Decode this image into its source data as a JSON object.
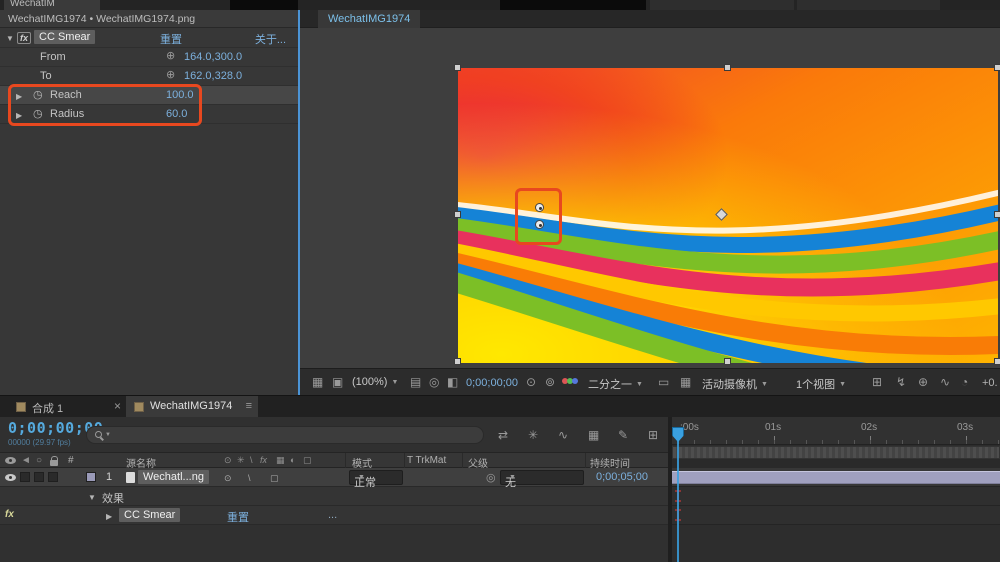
{
  "window": {
    "top_left_tab": "WechatIM"
  },
  "effect_controls": {
    "breadcrumb": "WechatIMG1974 • WechatIMG1974.png",
    "effect_name": "CC Smear",
    "reset": "重置",
    "about": "关于...",
    "rows": [
      {
        "label": "From",
        "value": "164.0,300.0"
      },
      {
        "label": "To",
        "value": "162.0,328.0"
      },
      {
        "label": "Reach",
        "value": "100.0"
      },
      {
        "label": "Radius",
        "value": "60.0"
      }
    ]
  },
  "viewer": {
    "tab": "WechatIMG1974",
    "toolbar": {
      "zoom": "(100%)",
      "time": "0;00;00;00",
      "resolution": "二分之一",
      "camera": "活动摄像机",
      "views": "1个视图",
      "exposure": "+0."
    }
  },
  "timeline": {
    "tabs": [
      {
        "label": "合成 1"
      },
      {
        "label": "WechatIMG1974"
      }
    ],
    "close": "×",
    "menu": "≡",
    "time_display": "0;00;00;00",
    "frame_info": "00000 (29.97 fps)",
    "columns": {
      "hash": "#",
      "source_name": "源名称",
      "mode": "模式",
      "trkmat": "T TrkMat",
      "parent": "父级",
      "duration": "持续时间"
    },
    "layer": {
      "index": "1",
      "name": "Wechatl...ng",
      "mode": "正常",
      "parent": "无",
      "duration": "0;00;05;00"
    },
    "effects_group": "效果",
    "effect_name": "CC Smear",
    "reset": "重置",
    "ellipsis": "...",
    "ruler": [
      ":00s",
      "01s",
      "02s",
      "03s"
    ]
  },
  "icons": {
    "twirl_open": "▼",
    "twirl_closed": "▶",
    "stopwatch": "◷",
    "point_picker": "⊕",
    "dropdown": "▼",
    "pickwhip": "◎",
    "fx": "fx",
    "audio": "◄",
    "solo": "○",
    "viewer": {
      "grid": "▦",
      "monitor": "▣",
      "ruler": "▤",
      "target": "◎",
      "mask": "◧",
      "camera": "⊙",
      "snapshot": "⊚",
      "roi": "▭",
      "tgrid": "▦",
      "share": "⊞",
      "fast": "↯",
      "pin": "⊕",
      "graph": "∿",
      "exposure": "◔"
    },
    "tl": {
      "flowchart": "⇄",
      "shy": "✳",
      "graph": "∿",
      "frameblend": "▦",
      "pencil": "✎",
      "brainstorm": "⊞",
      "switch_a": "⊙",
      "switch_b": "\\",
      "switch_c": "▢",
      "h_shy": "⊙",
      "h_collapse": "✳",
      "h_quality": "\\",
      "h_fx": "fx",
      "h_fb": "▦",
      "h_mb": "◐",
      "h_3d": "▢"
    }
  },
  "colors": {
    "accent_blue": "#7cb0dd",
    "annotation_orange": "#e8481f",
    "playhead_blue": "#3aa0e0",
    "layer_bar": "#a0a0bf"
  }
}
